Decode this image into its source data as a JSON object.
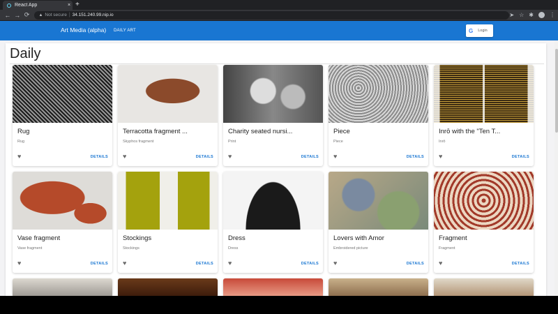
{
  "browser": {
    "tab_title": "React App",
    "tab_close": "×",
    "new_tab": "+",
    "security_label": "Not secure",
    "separator": "|",
    "url": "34.151.240.99.nip.io"
  },
  "appbar": {
    "brand": "Art Media (alpha)",
    "nav_daily": "DAILY ART",
    "login_label": "Login",
    "login_icon": "G"
  },
  "page": {
    "heading": "Daily",
    "details_label": "DETAILS",
    "cards": [
      {
        "title": "Rug",
        "subtitle": "Rug"
      },
      {
        "title": "Terracotta fragment ...",
        "subtitle": "Skyphos fragment"
      },
      {
        "title": "Charity seated nursi...",
        "subtitle": "Print"
      },
      {
        "title": "Piece",
        "subtitle": "Piece"
      },
      {
        "title": "Inrō with the \"Ten T...",
        "subtitle": "Inrō"
      },
      {
        "title": "Vase fragment",
        "subtitle": "Vase fragment"
      },
      {
        "title": "Stockings",
        "subtitle": "Stockings"
      },
      {
        "title": "Dress",
        "subtitle": "Dress"
      },
      {
        "title": "Lovers with Amor",
        "subtitle": "Embroidered picture"
      },
      {
        "title": "Fragment",
        "subtitle": "Fragment"
      }
    ]
  }
}
